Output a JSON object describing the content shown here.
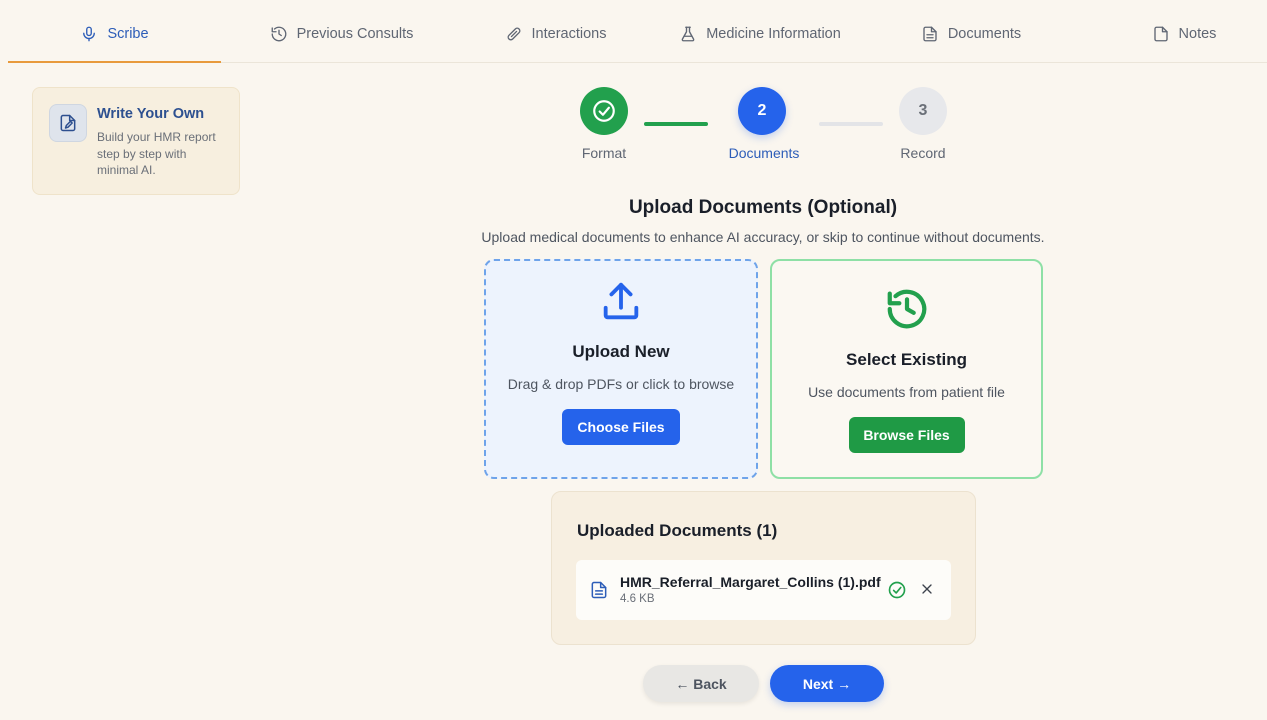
{
  "nav": {
    "tabs": [
      {
        "label": "Scribe",
        "icon": "microphone-icon",
        "active": true
      },
      {
        "label": "Previous Consults",
        "icon": "history-icon",
        "active": false
      },
      {
        "label": "Interactions",
        "icon": "pill-icon",
        "active": false
      },
      {
        "label": "Medicine Information",
        "icon": "flask-icon",
        "active": false
      },
      {
        "label": "Documents",
        "icon": "document-icon",
        "active": false
      },
      {
        "label": "Notes",
        "icon": "note-icon",
        "active": false
      }
    ]
  },
  "sidebar": {
    "card": {
      "title": "Write Your Own",
      "description": "Build your HMR report step by step with minimal AI.",
      "icon": "edit-document-icon"
    }
  },
  "stepper": {
    "steps": [
      {
        "number": "1",
        "label": "Format",
        "state": "done"
      },
      {
        "number": "2",
        "label": "Documents",
        "state": "current"
      },
      {
        "number": "3",
        "label": "Record",
        "state": "todo"
      }
    ]
  },
  "main": {
    "title": "Upload Documents (Optional)",
    "subtitle": "Upload medical documents to enhance AI accuracy, or skip to continue without documents."
  },
  "upload_new": {
    "title": "Upload New",
    "description": "Drag & drop PDFs or click to browse",
    "button": "Choose Files",
    "icon": "upload-icon"
  },
  "select_existing": {
    "title": "Select Existing",
    "description": "Use documents from patient file",
    "button": "Browse Files",
    "icon": "history-icon"
  },
  "uploaded": {
    "title": "Uploaded Documents (1)",
    "files": [
      {
        "name": "HMR_Referral_Margaret_Collins (1).pdf",
        "size": "4.6 KB",
        "status": "uploaded"
      }
    ]
  },
  "footer": {
    "back_label": "← Back",
    "next_label": "Next →"
  },
  "colors": {
    "primary": "#2563eb",
    "success": "#22a04d",
    "accent": "#e89a3c",
    "background": "#faf6ef"
  }
}
